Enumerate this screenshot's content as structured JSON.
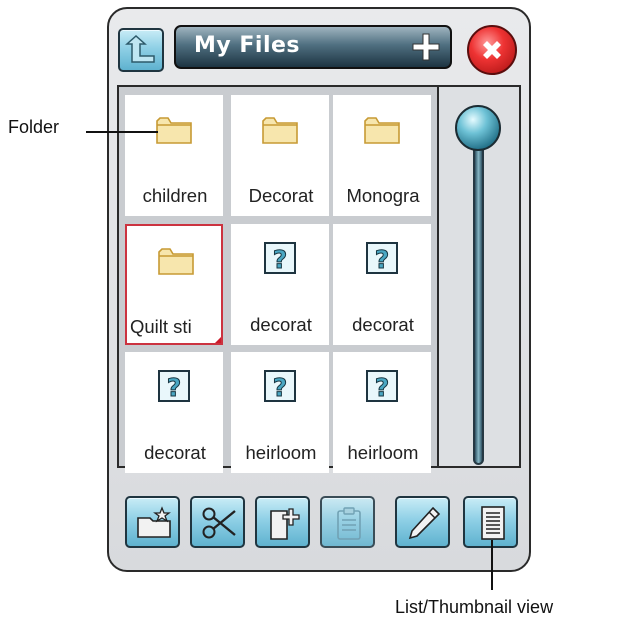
{
  "window": {
    "title": "My Files"
  },
  "files": [
    {
      "name": "children",
      "type": "folder"
    },
    {
      "name": "Decorat",
      "type": "folder"
    },
    {
      "name": "Monogra",
      "type": "folder"
    },
    {
      "name": "Quilt sti",
      "type": "folder",
      "selected": true
    },
    {
      "name": "decorat",
      "type": "unknown"
    },
    {
      "name": "decorat",
      "type": "unknown"
    },
    {
      "name": "decorat",
      "type": "unknown"
    },
    {
      "name": "heirloom",
      "type": "unknown"
    },
    {
      "name": "heirloom",
      "type": "unknown"
    }
  ],
  "toolbar": [
    "new-folder-icon",
    "scissors-icon",
    "new-file-icon",
    "clipboard-icon",
    "pencil-icon",
    "list-view-icon"
  ],
  "callouts": {
    "folder": "Folder",
    "list_view": "List/Thumbnail view"
  },
  "colors": {
    "button_blue": "#8fd0e6",
    "title_dark": "#1d3442",
    "close_red": "#e33333",
    "folder_yellow": "#f6e3a8",
    "selection_red": "#cc3340"
  }
}
